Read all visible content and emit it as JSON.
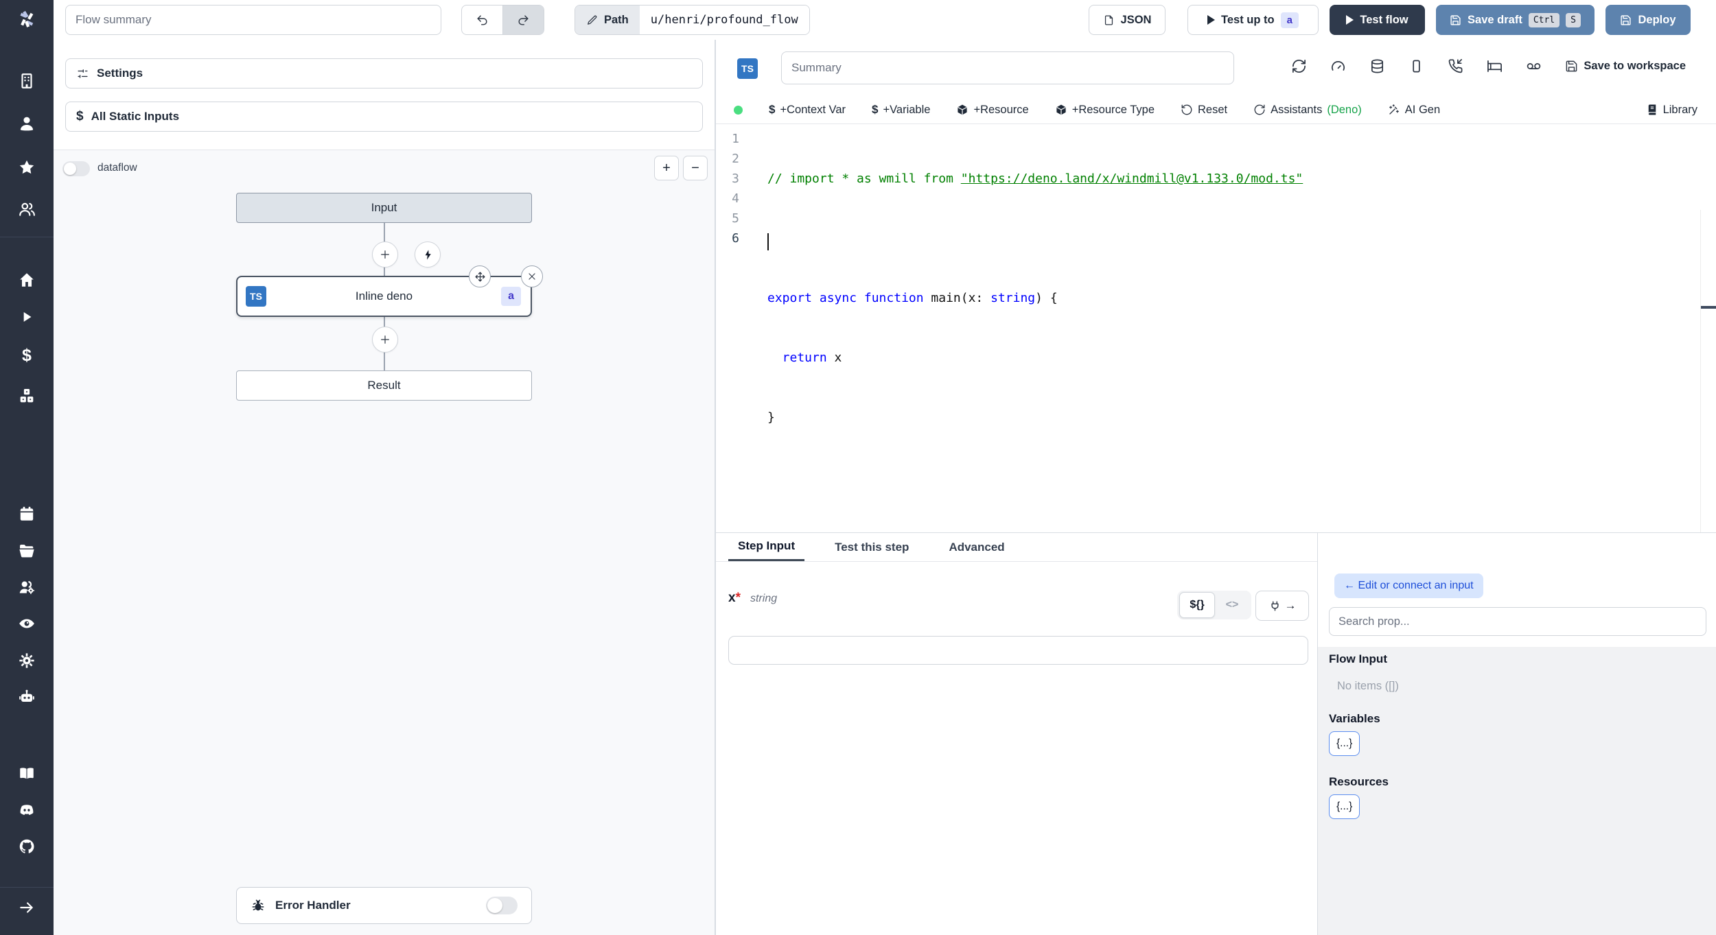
{
  "colors": {
    "sidebar_bg": "#2b3240",
    "accent_blue": "#5d83ae",
    "dark_button": "#2f3a4c",
    "link_blue": "#1d4ed8",
    "light_blue_bg": "#d7e5fd",
    "badge_indigo_bg": "#dfe5fc",
    "badge_indigo_text": "#4338ca",
    "ts_blue": "#3276c3",
    "green_dot": "#4ade80",
    "deno_green": "#16a34a",
    "code_comment": "#008000",
    "code_keyword": "#0000ff"
  },
  "topbar": {
    "flow_summary_placeholder": "Flow summary",
    "path_label": "Path",
    "path_value": "u/henri/profound_flow",
    "json_label": "JSON",
    "test_up_to_label": "Test up to",
    "test_up_to_badge": "a",
    "test_flow_label": "Test flow",
    "save_draft_label": "Save draft",
    "kbd_ctrl": "Ctrl",
    "kbd_s": "S",
    "deploy_label": "Deploy"
  },
  "left_panel": {
    "settings_label": "Settings",
    "all_static_inputs_label": "All Static Inputs",
    "dataflow_label": "dataflow",
    "zoom_in": "+",
    "zoom_out": "−",
    "input_node": "Input",
    "step_node_label": "Inline deno",
    "step_node_lang": "TS",
    "step_node_badge": "a",
    "result_node": "Result",
    "error_handler_label": "Error Handler"
  },
  "editor": {
    "lang_badge": "TS",
    "summary_placeholder": "Summary",
    "save_to_workspace": "Save to workspace",
    "dollar": "$",
    "context_var": "+Context Var",
    "variable": "+Variable",
    "resource": "+Resource",
    "resource_type": "+Resource Type",
    "reset": "Reset",
    "assistants": "Assistants ",
    "assistants_deno": "(Deno)",
    "ai_gen": "AI Gen",
    "library": "Library",
    "code": {
      "line_numbers": [
        "1",
        "2",
        "3",
        "4",
        "5",
        "6"
      ],
      "l1_comment": "// import * as wmill from ",
      "l1_url": "\"https://deno.land/x/windmill@v1.133.0/mod.ts\"",
      "l3_kw": "export async function",
      "l3_mid": " main(x: ",
      "l3_type": "string",
      "l3_end": ") {",
      "l4_kw": "  return",
      "l4_rest": " x",
      "l5": "}"
    }
  },
  "bottom": {
    "tabs": [
      "Step Input",
      "Test this step",
      "Advanced"
    ],
    "field_name": "x",
    "field_required": "*",
    "field_type": "string",
    "expr_toggle": "${}",
    "code_toggle": "<>",
    "plug_arrow": "→",
    "edit_connect_button": "← Edit or connect an input",
    "search_placeholder": "Search prop...",
    "flow_input_title": "Flow Input",
    "flow_input_empty": "No items ([])",
    "variables_title": "Variables",
    "variables_value": "{...}",
    "resources_title": "Resources",
    "resources_value": "{...}"
  }
}
